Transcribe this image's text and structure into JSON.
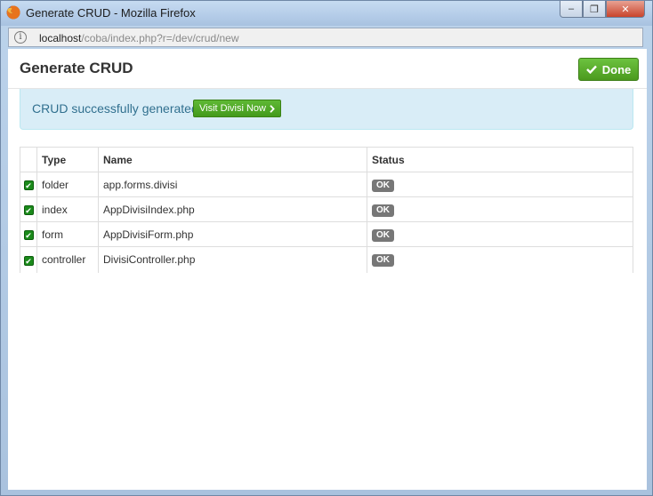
{
  "window": {
    "title": "Generate CRUD - Mozilla Firefox",
    "minimize_glyph": "–",
    "restore_glyph": "❐",
    "close_glyph": "✕"
  },
  "urlbar": {
    "host": "localhost",
    "path": "/coba/index.php?r=/dev/crud/new"
  },
  "modal": {
    "title": "Generate CRUD",
    "done_label": "Done"
  },
  "alert": {
    "message": "CRUD successfully generated!",
    "button_label": "Visit Divisi Now"
  },
  "table": {
    "headers": [
      "",
      "Type",
      "Name",
      "Status"
    ],
    "rows": [
      {
        "checked": true,
        "type": "folder",
        "name": "app.forms.divisi",
        "status": "OK"
      },
      {
        "checked": true,
        "type": "index",
        "name": "AppDivisiIndex.php",
        "status": "OK"
      },
      {
        "checked": true,
        "type": "form",
        "name": "AppDivisiForm.php",
        "status": "OK"
      },
      {
        "checked": true,
        "type": "controller",
        "name": "DivisiController.php",
        "status": "OK"
      }
    ]
  },
  "colors": {
    "success_green": "#5cb85c",
    "info_bg": "#d9edf7",
    "info_text": "#31708f",
    "badge_gray": "#777777"
  }
}
